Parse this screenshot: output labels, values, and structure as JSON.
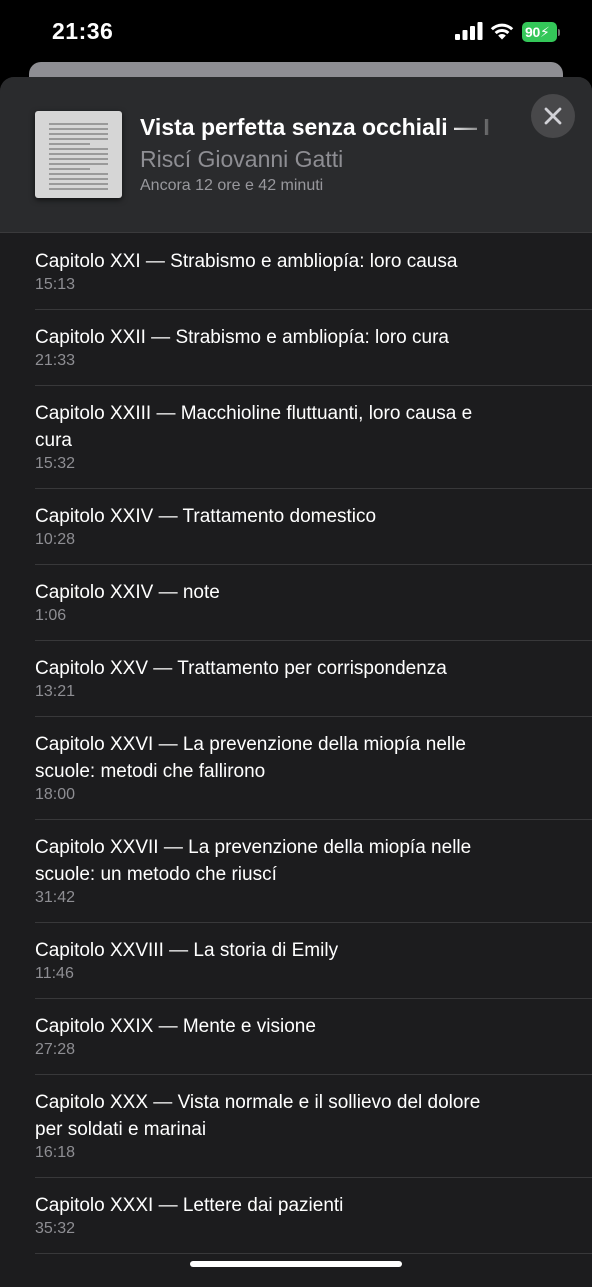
{
  "status_bar": {
    "time": "21:36",
    "battery_level": "90",
    "charging": true,
    "battery_color": "#34c759"
  },
  "header": {
    "title": "Vista perfetta senza occhiali — I",
    "author": "Riscí Giovanni Gatti",
    "remaining": "Ancora 12 ore e 42 minuti",
    "close_icon": "xmark-icon"
  },
  "chapters": [
    {
      "title": "Capitolo XXI — Strabismo e ambliopía: loro causa",
      "duration": "15:13"
    },
    {
      "title": "Capitolo XXII — Strabismo e ambliopía: loro cura",
      "duration": "21:33"
    },
    {
      "title": "Capitolo XXIII — Macchioline fluttuanti, loro causa e cura",
      "duration": "15:32"
    },
    {
      "title": "Capitolo XXIV — Trattamento domestico",
      "duration": "10:28"
    },
    {
      "title": "Capitolo XXIV — note",
      "duration": "1:06"
    },
    {
      "title": "Capitolo XXV — Trattamento per corrispondenza",
      "duration": "13:21"
    },
    {
      "title": "Capitolo XXVI — La prevenzione della miopía nelle scuole: metodi che fallirono",
      "duration": "18:00"
    },
    {
      "title": "Capitolo XXVII — La prevenzione della miopía nelle scuole: un metodo che riuscí",
      "duration": "31:42"
    },
    {
      "title": "Capitolo XXVIII — La storia di Emily",
      "duration": "11:46"
    },
    {
      "title": "Capitolo XXIX — Mente e visione",
      "duration": "27:28"
    },
    {
      "title": "Capitolo XXX — Vista normale e il sollievo del dolore per soldati e marinai",
      "duration": "16:18"
    },
    {
      "title": "Capitolo XXXI — Lettere dai pazienti",
      "duration": "35:32"
    }
  ]
}
